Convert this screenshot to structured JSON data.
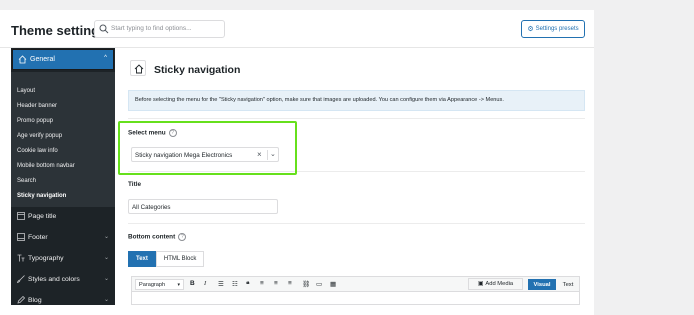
{
  "header": {
    "title": "Theme settings",
    "search_placeholder": "Start typing to find options...",
    "presets_label": "Settings presets"
  },
  "sidebar": {
    "general_label": "General",
    "subitems": [
      "Layout",
      "Header banner",
      "Promo popup",
      "Age verify popup",
      "Cookie law info",
      "Mobile bottom navbar",
      "Search",
      "Sticky navigation"
    ],
    "active_subitem": "Sticky navigation",
    "nav": [
      {
        "label": "Page title",
        "icon": "page-icon"
      },
      {
        "label": "Footer",
        "icon": "footer-icon"
      },
      {
        "label": "Typography",
        "icon": "typography-icon"
      },
      {
        "label": "Styles and colors",
        "icon": "brush-icon"
      },
      {
        "label": "Blog",
        "icon": "blog-icon"
      }
    ]
  },
  "main": {
    "page_title": "Sticky navigation",
    "notice": "Before selecting the menu for the \"Sticky navigation\" option, make sure that images are uploaded. You can configure them via Appearance -> Menus.",
    "select_menu_label": "Select menu",
    "select_menu_value": "Sticky navigation Mega Electronics",
    "title_label": "Title",
    "title_value": "All Categories",
    "bottom_content_label": "Bottom content",
    "tabs": [
      "Text",
      "HTML Block"
    ],
    "editor": {
      "format_value": "Paragraph",
      "add_media_label": "Add Media",
      "visual_label": "Visual",
      "text_label": "Text"
    },
    "help_glyph": "?"
  },
  "colors": {
    "accent": "#2271b1",
    "sidebar_bg": "#1d2327",
    "highlight": "#66e01c"
  }
}
